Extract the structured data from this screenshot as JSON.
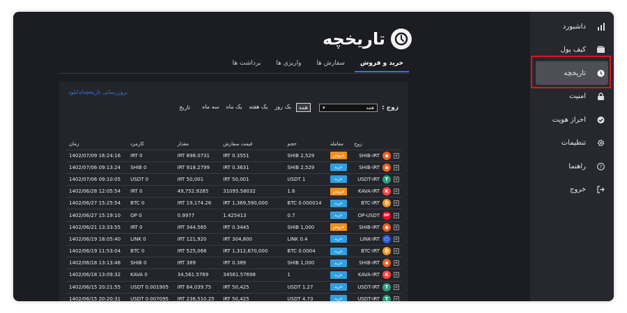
{
  "page": {
    "title": "تاریخچه"
  },
  "sidebar": {
    "items": [
      {
        "label": "داشبورد",
        "icon": "bar-chart-icon"
      },
      {
        "label": "کیف پول",
        "icon": "wallet-icon"
      },
      {
        "label": "تاریخچه",
        "icon": "clock-icon",
        "active": true
      },
      {
        "label": "امنیت",
        "icon": "lock-icon"
      },
      {
        "label": "احراز هویت",
        "icon": "check-circle-icon"
      },
      {
        "label": "تنظیمات",
        "icon": "gear-icon"
      },
      {
        "label": "راهنما",
        "icon": "question-icon"
      },
      {
        "label": "خروج",
        "icon": "logout-icon"
      }
    ]
  },
  "tabs": [
    {
      "label": "خرید و فروش",
      "active": true
    },
    {
      "label": "سفارش ها"
    },
    {
      "label": "واریزی ها"
    },
    {
      "label": "برداشت ها"
    }
  ],
  "download_link": "بروزرسانی تاریخچه/دانلود",
  "filters": {
    "pair_label": "زوج :",
    "pair_select": "همه",
    "periods": [
      {
        "label": "همه",
        "active": true
      },
      {
        "label": "یک روز"
      },
      {
        "label": "یک هفته"
      },
      {
        "label": "یک ماه"
      },
      {
        "label": "سه ماه"
      }
    ],
    "history_label": "تاریخ"
  },
  "table": {
    "headers": [
      "زوج",
      "معامله",
      "حجم",
      "قیمت سفارش",
      "مقدار",
      "کارمزد",
      "زمان"
    ],
    "rows": [
      {
        "pair": "SHIB-IRT",
        "coin": "shib",
        "side": "فروش",
        "side_type": "sell",
        "volume": "SHIB 2,529",
        "price": "IRT 0.3551",
        "amount": "IRT 898.0731",
        "fee": "IRT 0",
        "time": "16:24:16 1402/07/09"
      },
      {
        "pair": "SHIB-IRT",
        "coin": "shib",
        "side": "خرید",
        "side_type": "buy",
        "volume": "SHIB 2,529",
        "price": "IRT 0.3631",
        "amount": "IRT 918.2799",
        "fee": "SHIB 0",
        "time": "09:13:24 1402/07/06"
      },
      {
        "pair": "USDT-IRT",
        "coin": "usdt",
        "side": "خرید",
        "side_type": "buy",
        "volume": "USDT 1",
        "price": "IRT 50,001",
        "amount": "IRT 50,001",
        "fee": "USDT 0",
        "time": "09:10:05 1402/07/06"
      },
      {
        "pair": "KAVA-IRT",
        "coin": "kava",
        "side": "فروش",
        "side_type": "sell",
        "volume": "1.6",
        "price": "31095.58032",
        "amount": "49,752.9285",
        "fee": "IRT 0",
        "time": "12:05:54 1402/06/28"
      },
      {
        "pair": "BTC-IRT",
        "coin": "btc",
        "side": "خرید",
        "side_type": "buy",
        "volume": "BTC 0.000014",
        "price": "IRT 1,369,590,000",
        "amount": "IRT 19,174.26",
        "fee": "BTC 0",
        "time": "15:25:54 1402/06/27"
      },
      {
        "pair": "OP-USDT",
        "coin": "op",
        "side": "خرید",
        "side_type": "buy",
        "volume": "0.7",
        "price": "1.425413",
        "amount": "0.9977",
        "fee": "OP 0",
        "time": "15:19:10 1402/06/27"
      },
      {
        "pair": "SHIB-IRT",
        "coin": "shib",
        "side": "فروش",
        "side_type": "sell",
        "volume": "SHIB 1,000",
        "price": "IRT 0.3445",
        "amount": "IRT 344.565",
        "fee": "IRT 0",
        "time": "13:33:55 1402/06/21"
      },
      {
        "pair": "LINK-IRT",
        "coin": "link",
        "side": "خرید",
        "side_type": "buy",
        "volume": "LINK 0.4",
        "price": "IRT 304,800",
        "amount": "IRT 121,920",
        "fee": "LINK 0",
        "time": "18:05:40 1402/06/19"
      },
      {
        "pair": "BTC-IRT",
        "coin": "btc",
        "side": "خرید",
        "side_type": "buy",
        "volume": "BTC 0.0004",
        "price": "IRT 1,312,670,000",
        "amount": "IRT 525,068",
        "fee": "BTC 0",
        "time": "11:53:04 1402/06/19"
      },
      {
        "pair": "SHIB-IRT",
        "coin": "shib",
        "side": "خرید",
        "side_type": "buy",
        "volume": "SHIB 1,000",
        "price": "IRT 0.389",
        "amount": "IRT 389",
        "fee": "SHIB 0",
        "time": "13:13:46 1402/06/18"
      },
      {
        "pair": "KAVA-IRT",
        "coin": "kava",
        "side": "خرید",
        "side_type": "buy",
        "volume": "1",
        "price": "34561.57698",
        "amount": "34,561.5769",
        "fee": "KAVA 0",
        "time": "13:09:32 1402/06/18"
      },
      {
        "pair": "USDT-IRT",
        "coin": "usdt",
        "side": "خرید",
        "side_type": "buy",
        "volume": "USDT 1.27",
        "price": "IRT 50,425",
        "amount": "IRT 64,039.75",
        "fee": "USDT 0.001905",
        "time": "20:21:55 1402/06/15"
      },
      {
        "pair": "USDT-IRT",
        "coin": "usdt",
        "side": "خرید",
        "side_type": "buy",
        "volume": "USDT 4.73",
        "price": "IRT 50,425",
        "amount": "IRT 238,510.25",
        "fee": "USDT 0.007095",
        "time": "20:20:31 1402/06/15"
      },
      {
        "pair": "KAVA-IRT",
        "coin": "kava",
        "side": "خرید",
        "side_type": "buy",
        "volume": "15",
        "price": "33005.802590000005",
        "amount": "495,087.039",
        "fee": "KAVA 0",
        "time": "22:17:14 1402/06/13"
      }
    ]
  },
  "colors": {
    "sell": "#f0901e",
    "buy": "#2f9fe0",
    "shib": "#f35d1d",
    "usdt": "#26a17b",
    "kava": "#ff433e",
    "btc": "#f7931a",
    "op": "#ff0420",
    "link": "#2a5ada",
    "accent": "#3d6fd6",
    "highlight": "#e0141d"
  }
}
